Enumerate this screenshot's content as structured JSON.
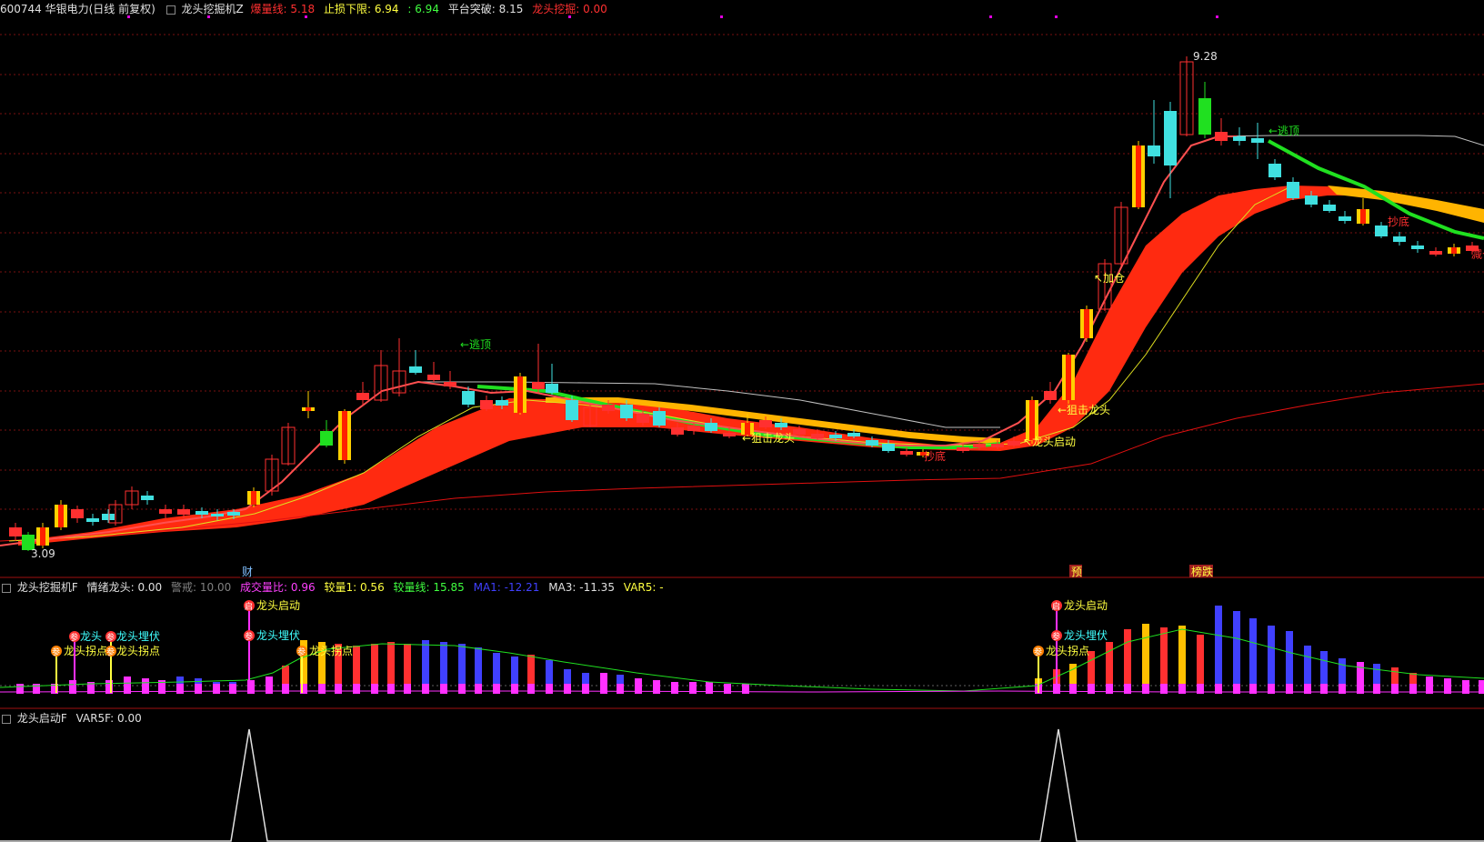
{
  "header": {
    "symbol": "600744 华银电力(日线 前复权)",
    "indicator": "龙头挖掘机Z",
    "burst_label": "爆量线:",
    "burst_value": "5.18",
    "stop_label": "止损下限:",
    "stop_value": "6.94",
    "stop_value2": ": 6.94",
    "platform_label": "平台突破:",
    "platform_value": "8.15",
    "dig_label": "龙头挖掘:",
    "dig_value": "0.00",
    "colors": {
      "red": "#ff3030",
      "yellow": "#ffff40",
      "white": "#e0e0e0"
    }
  },
  "price_panel": {
    "high_label": "9.28",
    "low_label": "3.09",
    "markers": [
      "财",
      "预",
      "榜跌"
    ],
    "annotations": {
      "escape_top_1": "←逃顶",
      "escape_top_2": "←逃顶",
      "snipe_1": "←狙击龙头",
      "snipe_2": "←狙击龙头",
      "dragon_start": "↖龙头启动",
      "add_position": "↖加仓",
      "bottom_1": "抄底",
      "bottom_2": "抄底",
      "bottom_3": "减仓"
    }
  },
  "volume_panel": {
    "indicator": "龙头挖掘机F",
    "emotion_label": "情绪龙头:",
    "emotion_value": "0.00",
    "alert_label": "警戒:",
    "alert_value": "10.00",
    "vol_ratio_label": "成交量比:",
    "vol_ratio_value": "0.96",
    "compare1_label": "较量1:",
    "compare1_value": "0.56",
    "compare_line_label": "较量线:",
    "compare_line_value": "15.85",
    "ma1_label": "MA1:",
    "ma1_value": "-12.21",
    "ma3_label": "MA3:",
    "ma3_value": "-11.35",
    "var5_label": "VAR5:",
    "var5_value": "-",
    "signals": {
      "start_1": "龙头启动",
      "ambush_1": "龙头埋伏",
      "ambush_2": "龙头埋伏",
      "turn_1": "龙头拐点",
      "turn_2": "龙头拐点",
      "turn_3": "龙头拐点",
      "start_2": "龙头启动",
      "ambush_3": "龙头埋伏",
      "turn_4": "龙头拐点",
      "short_1": "龙头",
      "badge_qi": "启",
      "badge_can": "参"
    }
  },
  "oscillator_panel": {
    "indicator": "龙头启动F",
    "var_label": "VAR5F:",
    "var_value": "0.00"
  }
}
